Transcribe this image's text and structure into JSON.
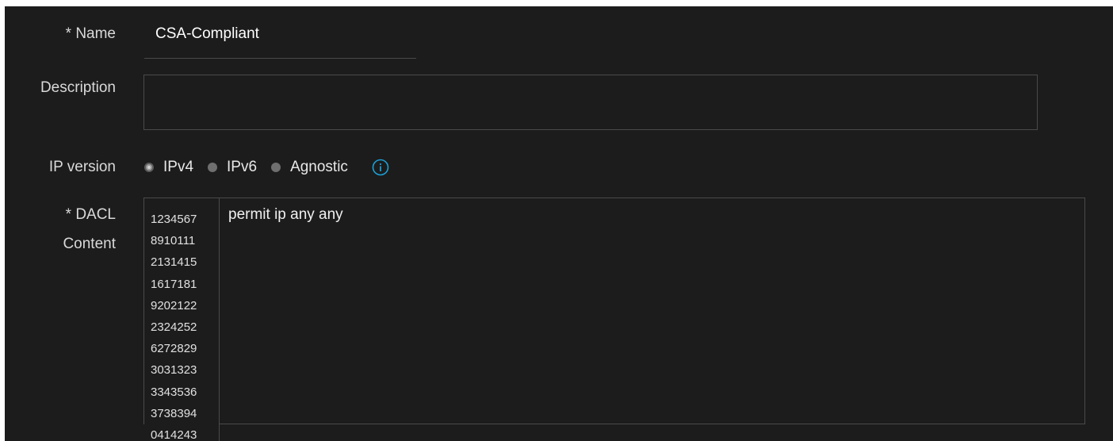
{
  "form": {
    "name_label": "* Name",
    "name_value": "CSA-Compliant",
    "description_label": "Description",
    "description_value": "",
    "ip_version_label": "IP version",
    "ip_versions": [
      {
        "label": "IPv4",
        "selected": true
      },
      {
        "label": "IPv6",
        "selected": false
      },
      {
        "label": "Agnostic",
        "selected": false
      }
    ],
    "info_icon": "info-circle-icon",
    "dacl_label_line1": "* DACL",
    "dacl_label_line2": "Content",
    "dacl_line_numbers": [
      "1234567",
      "8910111",
      "2131415",
      "1617181",
      "9202122",
      "2324252",
      "6272829",
      "3031323",
      "3343536",
      "3738394",
      "0414243"
    ],
    "dacl_content": "permit ip any any"
  },
  "colors": {
    "background": "#1c1c1c",
    "border": "#4a4a4a",
    "accent": "#1ba0d7"
  }
}
